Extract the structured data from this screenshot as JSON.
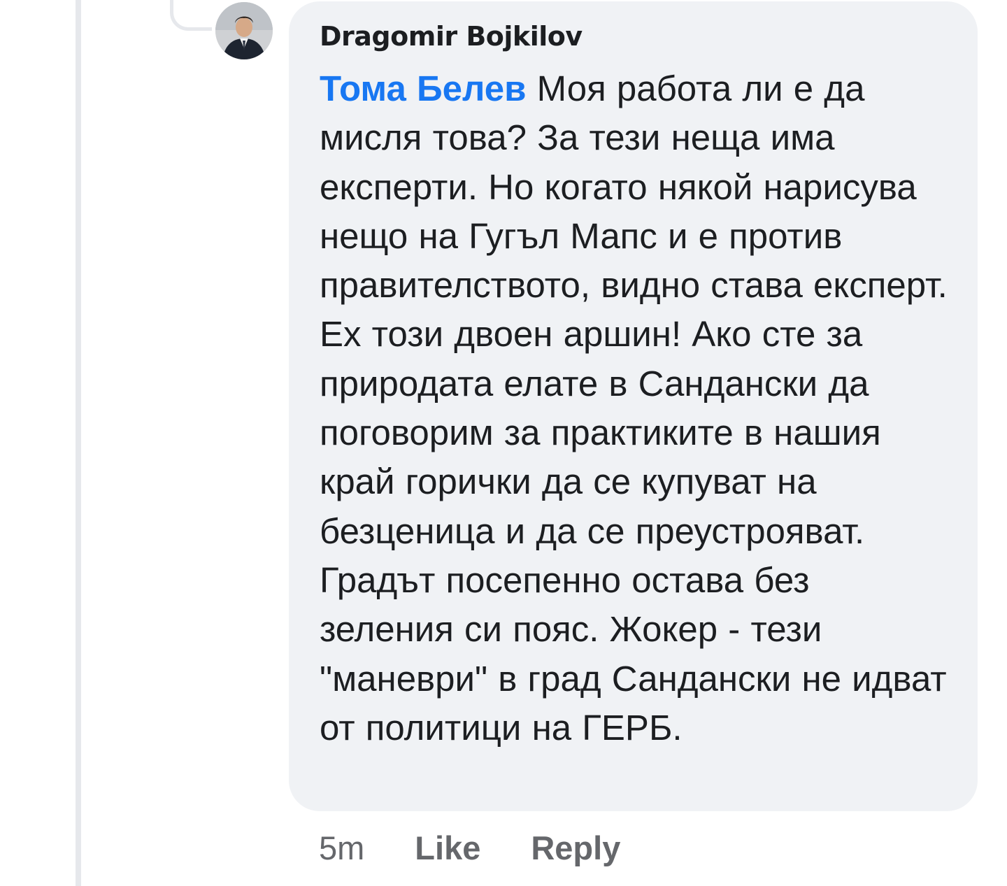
{
  "comment": {
    "author": "Dragomir Bojkilov",
    "mention": "Тома Белев",
    "text": " Моя работа ли е да мисля това? За тези неща има експерти. Но когато някой нарисува нещо на Гугъл Мапс и е против правителството, видно става експерт. Ех този двоен аршин! Ако сте за природата елате в Сандански да поговорим за практиките в нашия край горички да се купуват на безценица и да се преустрояват. Градът посепенно остава без зеления си пояс. Жокер - тези \"маневри\" в град Сандански не идват от политици на ГЕРБ."
  },
  "actions": {
    "time": "5m",
    "like": "Like",
    "reply": "Reply"
  },
  "colors": {
    "mention": "#1877f2",
    "bubble": "#f0f2f5",
    "meta": "#65676b"
  }
}
